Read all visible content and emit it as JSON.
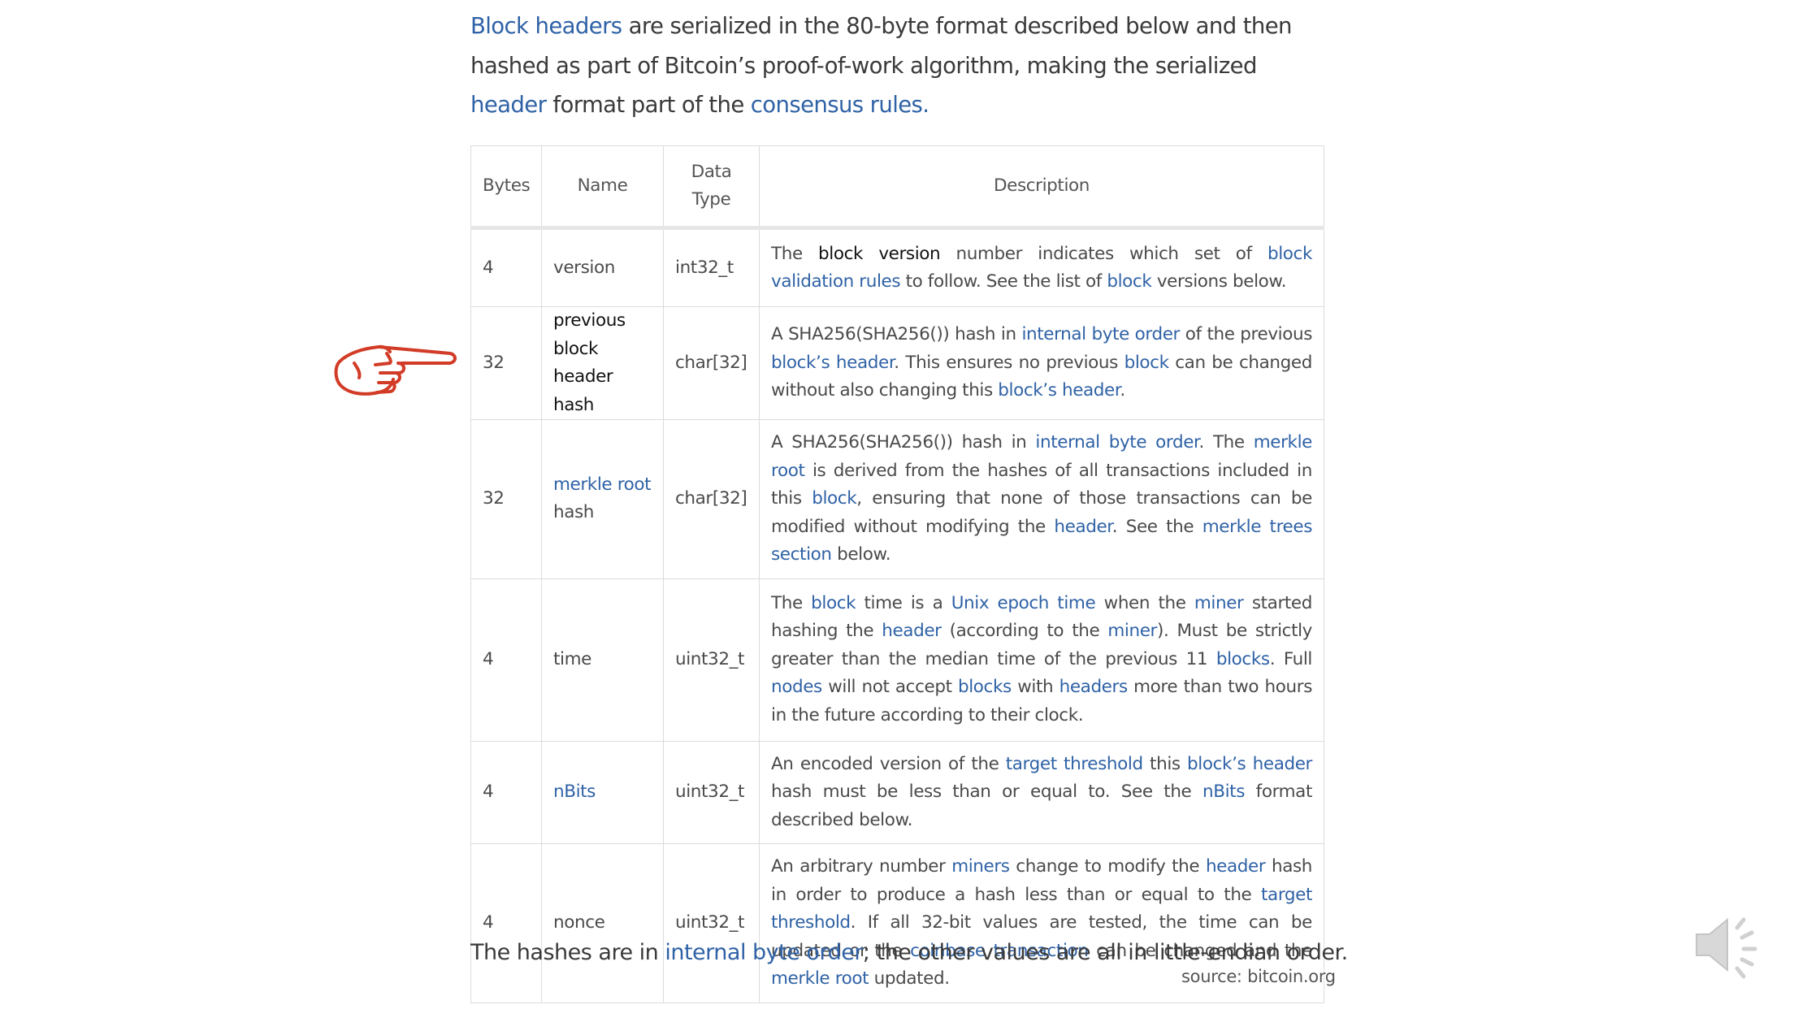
{
  "intro": {
    "link_block_headers": "Block headers",
    "text_1": " are serialized in the 80-byte format described below and then hashed as part of Bitcoin’s proof-of-work algorithm, making the serialized ",
    "link_header": "header",
    "text_2": " format part of the ",
    "link_consensus_rules": "consensus rules.",
    "text_3": ""
  },
  "table": {
    "headers": {
      "bytes": "Bytes",
      "name": "Name",
      "type": "Data Type",
      "desc": "Description"
    },
    "rows": [
      {
        "bytes": "4",
        "name": "version",
        "type": "int32_t",
        "desc": [
          {
            "t": "The "
          },
          {
            "t": "block version",
            "c": "dark"
          },
          {
            "t": " number indicates which set of "
          },
          {
            "t": "block validation rules",
            "c": "lnk"
          },
          {
            "t": " to follow. See the list of "
          },
          {
            "t": "block",
            "c": "lnk"
          },
          {
            "t": " versions below."
          }
        ]
      },
      {
        "bytes": "32",
        "name": "previous block header hash",
        "type": "char[32]",
        "desc": [
          {
            "t": "A SHA256(SHA256()) hash in "
          },
          {
            "t": "internal byte order",
            "c": "lnk"
          },
          {
            "t": " of the previous "
          },
          {
            "t": "block’s header",
            "c": "lnk"
          },
          {
            "t": ". This ensures no previous "
          },
          {
            "t": "block",
            "c": "lnk"
          },
          {
            "t": " can be changed without also changing this "
          },
          {
            "t": "block’s header",
            "c": "lnk"
          },
          {
            "t": "."
          }
        ]
      },
      {
        "bytes": "32",
        "name_link": "merkle root",
        "name_rest": " hash",
        "type": "char[32]",
        "desc": [
          {
            "t": "A SHA256(SHA256()) hash in "
          },
          {
            "t": "internal byte order",
            "c": "lnk"
          },
          {
            "t": ". The "
          },
          {
            "t": "merkle root",
            "c": "lnk"
          },
          {
            "t": " is derived from the hashes of all transactions included in this "
          },
          {
            "t": "block",
            "c": "lnk"
          },
          {
            "t": ", ensuring that none of those transactions can be modified without modifying the "
          },
          {
            "t": "header",
            "c": "lnk"
          },
          {
            "t": ". See the "
          },
          {
            "t": "merkle trees section",
            "c": "lnk"
          },
          {
            "t": " below."
          }
        ]
      },
      {
        "bytes": "4",
        "name": "time",
        "type": "uint32_t",
        "desc": [
          {
            "t": "The "
          },
          {
            "t": "block",
            "c": "lnk"
          },
          {
            "t": " time is a "
          },
          {
            "t": "Unix epoch time",
            "c": "lnk"
          },
          {
            "t": " when the "
          },
          {
            "t": "miner",
            "c": "lnk"
          },
          {
            "t": " started hashing the "
          },
          {
            "t": "header",
            "c": "lnk"
          },
          {
            "t": " (according to the "
          },
          {
            "t": "miner",
            "c": "lnk"
          },
          {
            "t": "). Must be strictly greater than the median time of the previous 11 "
          },
          {
            "t": "blocks",
            "c": "lnk"
          },
          {
            "t": ". Full "
          },
          {
            "t": "nodes",
            "c": "lnk"
          },
          {
            "t": " will not accept "
          },
          {
            "t": "blocks",
            "c": "lnk"
          },
          {
            "t": " with "
          },
          {
            "t": "headers",
            "c": "lnk"
          },
          {
            "t": " more than two hours in the future according to their clock."
          }
        ]
      },
      {
        "bytes": "4",
        "name_link": "nBits",
        "type": "uint32_t",
        "desc": [
          {
            "t": "An encoded version of the "
          },
          {
            "t": "target threshold",
            "c": "lnk"
          },
          {
            "t": " this "
          },
          {
            "t": "block’s header",
            "c": "lnk"
          },
          {
            "t": " hash must be less than or equal to. See the "
          },
          {
            "t": "nBits",
            "c": "lnk"
          },
          {
            "t": " format described below."
          }
        ]
      },
      {
        "bytes": "4",
        "name": "nonce",
        "type": "uint32_t",
        "desc": [
          {
            "t": "An arbitrary number "
          },
          {
            "t": "miners",
            "c": "lnk"
          },
          {
            "t": " change to modify the "
          },
          {
            "t": "header",
            "c": "lnk"
          },
          {
            "t": " hash in order to produce a hash less than or equal to the "
          },
          {
            "t": "target threshold",
            "c": "lnk"
          },
          {
            "t": ". If all 32-bit values are tested, the time can be updated or the "
          },
          {
            "t": "coinbase transaction",
            "c": "lnk"
          },
          {
            "t": " can be changed and the "
          },
          {
            "t": "merkle root",
            "c": "lnk"
          },
          {
            "t": " updated."
          }
        ]
      }
    ]
  },
  "outro": {
    "text_1": "The hashes are in ",
    "link": "internal byte order",
    "text_2": "; the other values are all in little-endian order."
  },
  "source": "source: bitcoin.org",
  "icons": {
    "pointer": "pointing-hand-icon",
    "sound": "speaker-icon"
  },
  "colors": {
    "link": "#2f62a6",
    "pointer": "#d23b26",
    "text": "#3a3a3a"
  }
}
